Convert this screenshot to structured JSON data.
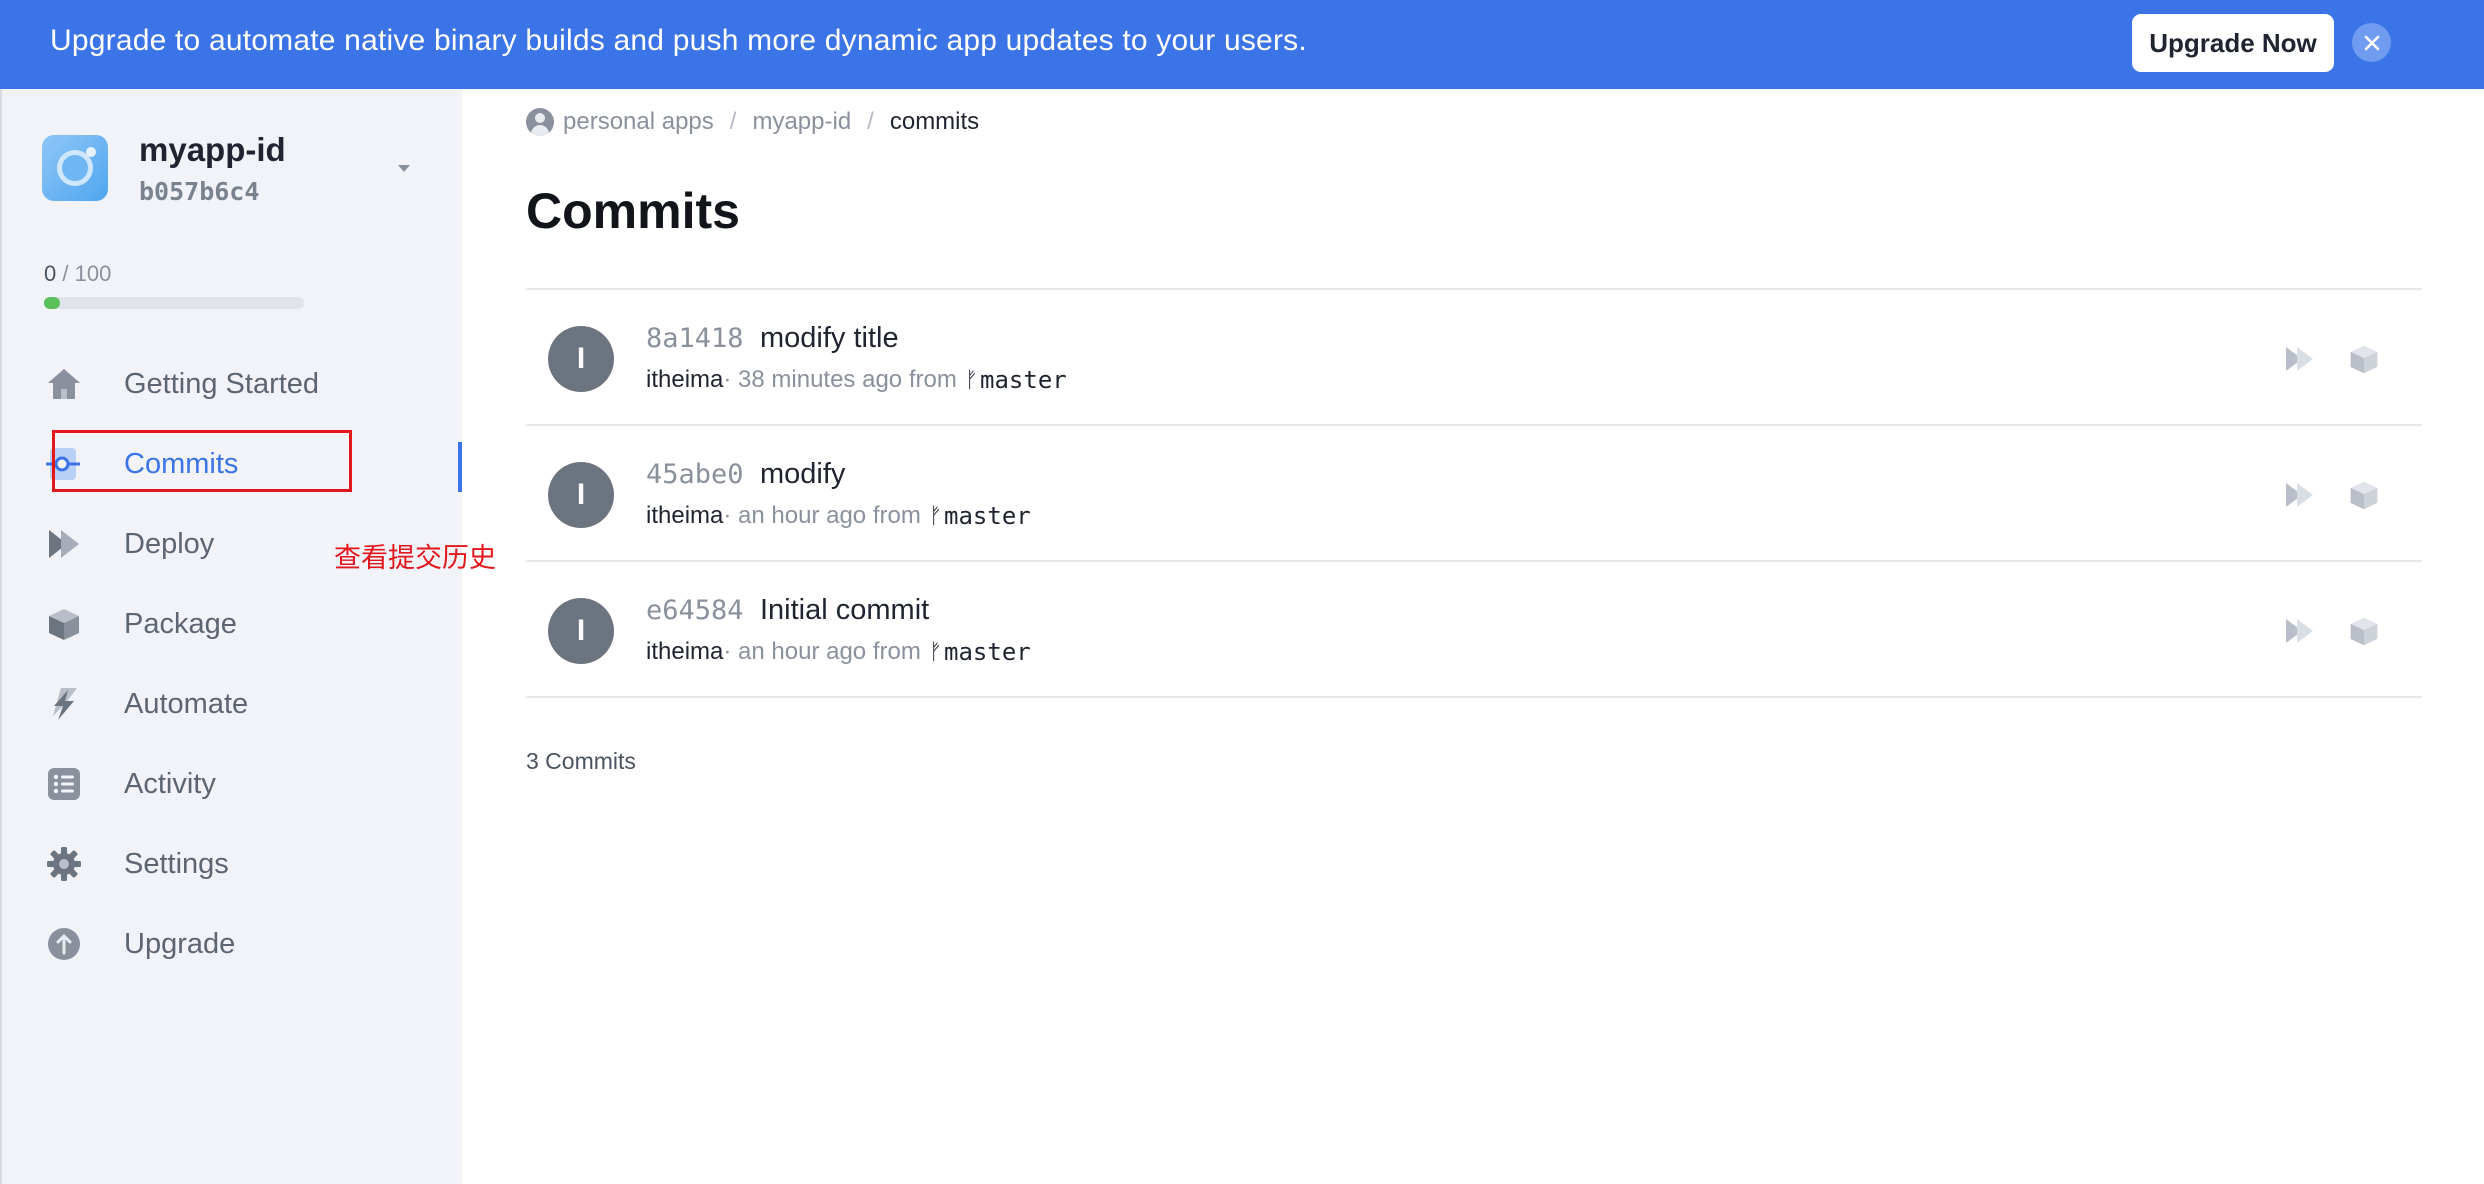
{
  "banner": {
    "text": "Upgrade to automate native binary builds and push more dynamic app updates to your users.",
    "button_label": "Upgrade Now",
    "close_icon": "close-icon",
    "background_color": "#3b74e6"
  },
  "app": {
    "name": "myapp-id",
    "id": "b057b6c4",
    "usage_current": "0",
    "usage_separator": " / ",
    "usage_limit": "100",
    "usage_fraction": 0.06
  },
  "sidebar": {
    "items": [
      {
        "label": "Getting Started",
        "icon": "home-icon"
      },
      {
        "label": "Commits",
        "icon": "commit-icon",
        "active": true
      },
      {
        "label": "Deploy",
        "icon": "deploy-icon"
      },
      {
        "label": "Package",
        "icon": "package-icon"
      },
      {
        "label": "Automate",
        "icon": "automate-icon"
      },
      {
        "label": "Activity",
        "icon": "activity-icon"
      },
      {
        "label": "Settings",
        "icon": "settings-icon"
      },
      {
        "label": "Upgrade",
        "icon": "upgrade-icon"
      }
    ],
    "accent_color": "#3b74e6"
  },
  "annotation": {
    "text": "查看提交历史",
    "color": "#e3161b"
  },
  "breadcrumb": {
    "items": [
      "personal apps",
      "myapp-id",
      "commits"
    ],
    "separator": "/"
  },
  "page": {
    "title": "Commits"
  },
  "commits": [
    {
      "avatar": "I",
      "sha": "8a1418",
      "message": "modify title",
      "author": "itheima",
      "time": " · 38 minutes ago from ",
      "branch": "master"
    },
    {
      "avatar": "I",
      "sha": "45abe0",
      "message": "modify",
      "author": "itheima",
      "time": " · an hour ago from ",
      "branch": "master"
    },
    {
      "avatar": "I",
      "sha": "e64584",
      "message": "Initial commit",
      "author": "itheima",
      "time": " · an hour ago from ",
      "branch": "master"
    }
  ],
  "footer": {
    "commit_count": "3 Commits"
  }
}
